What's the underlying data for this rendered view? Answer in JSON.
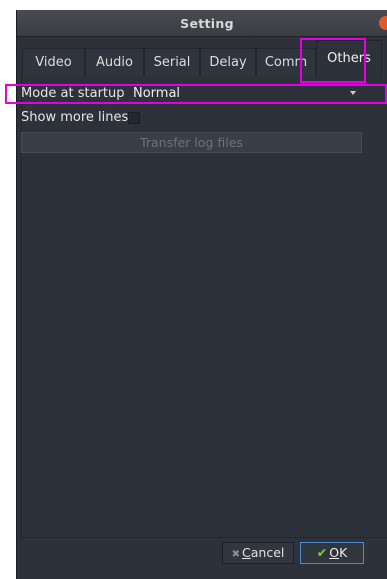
{
  "window": {
    "title": "Setting"
  },
  "tabs": [
    {
      "label": "Video"
    },
    {
      "label": "Audio"
    },
    {
      "label": "Serial"
    },
    {
      "label": "Delay"
    },
    {
      "label": "Comm"
    },
    {
      "label": "Others",
      "selected": true
    }
  ],
  "others": {
    "mode_label": "Mode at startup",
    "mode_value": "Normal",
    "more_lines_label": "Show more lines",
    "more_lines_checked": false,
    "transfer_button": "Transfer log files"
  },
  "buttons": {
    "cancel_first": "C",
    "cancel_rest": "ancel",
    "ok_first": "O",
    "ok_rest": "K"
  },
  "icons": {
    "close": "close-icon",
    "cancel": "x-icon",
    "ok": "check-icon",
    "dropdown": "dropdown-arrow-icon"
  },
  "colors": {
    "highlight": "#e400e4",
    "background": "#2c313a",
    "ok_border": "#4b8bd0",
    "check": "#7ad61f"
  }
}
